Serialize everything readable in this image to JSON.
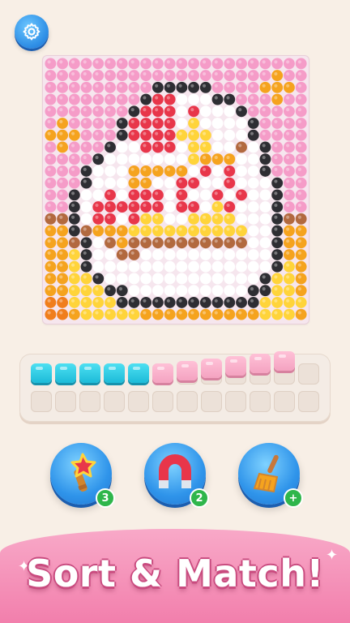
{
  "colors": {
    "P": "#f59cc8",
    "K": "#2e2e33",
    "W": "#ffffff",
    "R": "#e8364a",
    "Y": "#ffd43a",
    "O": "#f5a31e",
    "B": "#b2693f",
    "D": "#f07e1c",
    "_": "#f3dfe8"
  },
  "board": {
    "rows": [
      "PPPPPPPPPPPPPPPPPPPPPP",
      "PPPPPPPPPPPPPPPPPPPOPP",
      "PPPPPPPPPKKKKKPPPPOOOP",
      "PPPPPPPPKRRWWWKKPPPOPP",
      "PPPPPPPKRRRWRWWWKPPPPP",
      "POPPPPKRRRRWYWWWWKPPPP",
      "OOOPPPKRRRRYYYWWWKPPPP",
      "POPPPKWWRRRWYYWWBWKPPP",
      "PPPPKWWWWWWWYOOOWWKPPP",
      "PPPKWWWOOOOOWRWRWWKPPP",
      "PPPKWWWOOWWRRWWRWWWKPP",
      "PPKWWRWRRRWRWWRWRWWKPP",
      "PPKWRRRRRRWRRWYRWWWKPP",
      "BBKWRRWRYYWWYYYYWWWKBB",
      "OOKBOOOYYYYYYYYYYWWKOO",
      "OOBKWBOBBBBBBBBBBWWKOO",
      "OOYKWWBBWWWWWWWWWWWKOO",
      "OOYKWWWWWWWWWWWWWWWKYO",
      "OOYYKWWWWWWWWWWWWWKYYO",
      "OOYYYKKWWWWWWWWWWKKYYO",
      "DDYYYYKKKKKKKKKKKKYYYY",
      "DDOYYYYYOOOOOOOOOOYYYO"
    ]
  },
  "tray": {
    "top_row": [
      "cyan",
      "cyan",
      "cyan",
      "cyan",
      "cyan",
      "pink",
      "pink",
      "pink",
      "pink",
      "pink",
      "pink",
      "empty"
    ],
    "slot_count": 12
  },
  "boosters": [
    {
      "name": "magic-wand",
      "badge": "3"
    },
    {
      "name": "magnet",
      "badge": "2"
    },
    {
      "name": "broom",
      "badge": "+"
    }
  ],
  "banner": {
    "title": "Sort & Match!"
  },
  "icons": {
    "settings": "gear-icon",
    "sparkle": "sparkle-icon"
  }
}
